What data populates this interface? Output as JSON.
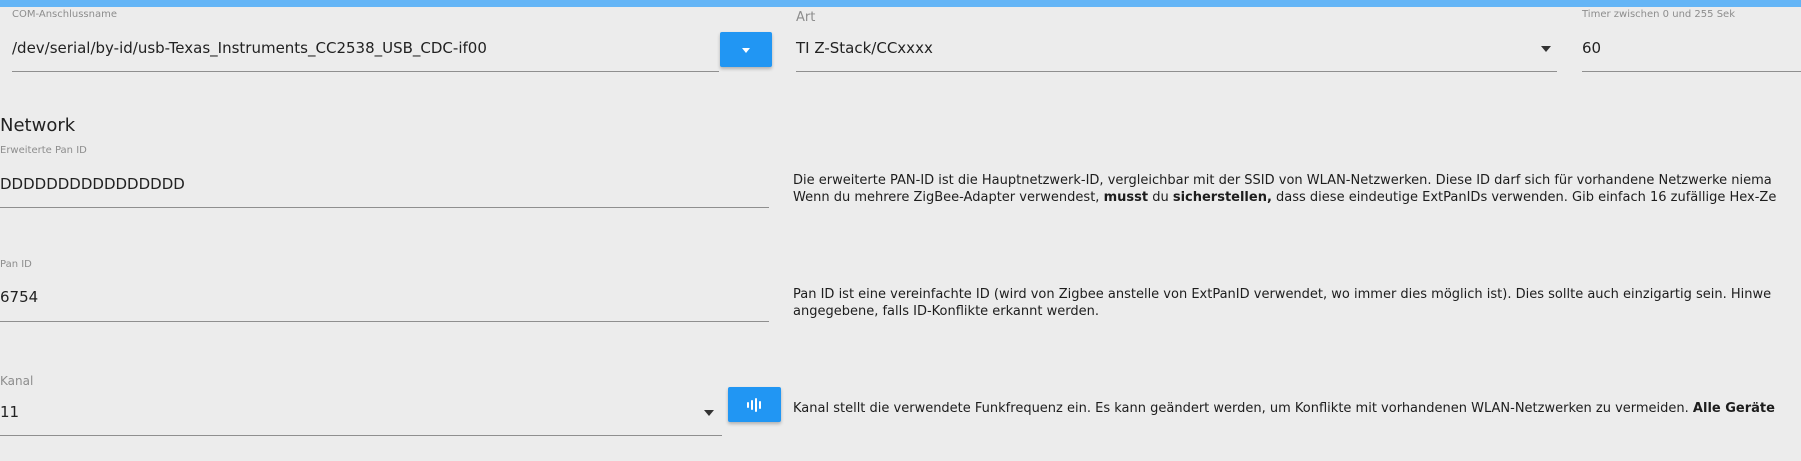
{
  "top": {
    "com_port": {
      "label": "COM-Anschlussname",
      "value": "/dev/serial/by-id/usb-Texas_Instruments_CC2538_USB_CDC-if00"
    },
    "type": {
      "label": "Art",
      "value": "TI Z-Stack/CCxxxx"
    },
    "timer": {
      "label": "Timer zwischen 0 und 255 Sek",
      "value": "60"
    }
  },
  "network": {
    "title": "Network",
    "ext_pan_id": {
      "label": "Erweiterte Pan ID",
      "value": "DDDDDDDDDDDDDDDD",
      "desc_line1": "Die erweiterte PAN-ID ist die Hauptnetzwerk-ID, vergleichbar mit der SSID von WLAN-Netzwerken. Diese ID darf sich für vorhandene Netzwerke niema",
      "desc_line2_a": "Wenn du mehrere ZigBee-Adapter verwendest, ",
      "desc_line2_b": "musst",
      "desc_line2_c": " du ",
      "desc_line2_d": "sicherstellen,",
      "desc_line2_e": " dass diese eindeutige ExtPanIDs verwenden. Gib einfach 16 zufällige Hex-Ze"
    },
    "pan_id": {
      "label": "Pan ID",
      "value": "6754",
      "desc_line1": "Pan ID ist eine vereinfachte ID (wird von Zigbee anstelle von ExtPanID verwendet, wo immer dies möglich ist). Dies sollte auch einzigartig sein. Hinwe",
      "desc_line2": "angegebene, falls ID-Konflikte erkannt werden."
    },
    "channel": {
      "label": "Kanal",
      "value": "11",
      "desc_a": "Kanal stellt die verwendete Funkfrequenz ein. Es kann geändert werden, um Konflikte mit vorhandenen WLAN-Netzwerken zu vermeiden. ",
      "desc_b": "Alle Geräte"
    }
  },
  "icons": {
    "dropdown_button": "triangle-down-icon",
    "select_arrow": "chevron-down-icon",
    "scan_button": "waveform-icon"
  },
  "colors": {
    "accent": "#2196f3",
    "top_bar": "#64b5f6",
    "background": "#ececec"
  }
}
